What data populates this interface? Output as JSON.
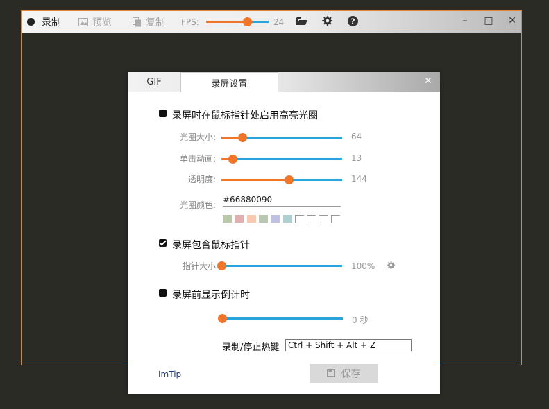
{
  "toolbar": {
    "record_label": "录制",
    "preview_label": "预览",
    "copy_label": "复制",
    "fps_label": "FPS:",
    "fps_value": "24",
    "fps_fraction": 0.66
  },
  "window_buttons": {
    "minimize": "–",
    "maximize": "□",
    "close": "✕"
  },
  "dialog": {
    "tabs": [
      "GIF",
      "录屏设置"
    ],
    "active_tab": 1,
    "close": "✕",
    "highlight": {
      "checkbox_label": "录屏时在鼠标指针处启用高亮光圈",
      "checked": false,
      "size_label": "光圈大小:",
      "size_value": "64",
      "size_fraction": 0.17,
      "click_anim_label": "单击动画:",
      "click_anim_value": "13",
      "click_anim_fraction": 0.09,
      "opacity_label": "透明度:",
      "opacity_value": "144",
      "opacity_fraction": 0.56,
      "color_label": "光圈颜色:",
      "color_value": "#66880090",
      "swatches": [
        "#b8c8a8",
        "#e0b0b0",
        "#f8c8b0",
        "#b8c8b0",
        "#c0c0e0",
        "#b0d0d0",
        "",
        "",
        "",
        ""
      ]
    },
    "cursor": {
      "checkbox_label": "录屏包含鼠标指针",
      "checked": true,
      "size_label": "指针大小",
      "size_value": "100%",
      "size_fraction": 0.0
    },
    "countdown": {
      "checkbox_label": "录屏前显示倒计时",
      "checked": false,
      "value": "0 秒",
      "fraction": 0.0
    },
    "hotkey_label": "录制/停止热键",
    "hotkey_value": "Ctrl + Shift + Alt + Z",
    "link": "ImTip",
    "save_label": "保存"
  },
  "colors": {
    "accent": "#f0762a",
    "track": "#2aa4dc",
    "border": "#e0843a"
  }
}
